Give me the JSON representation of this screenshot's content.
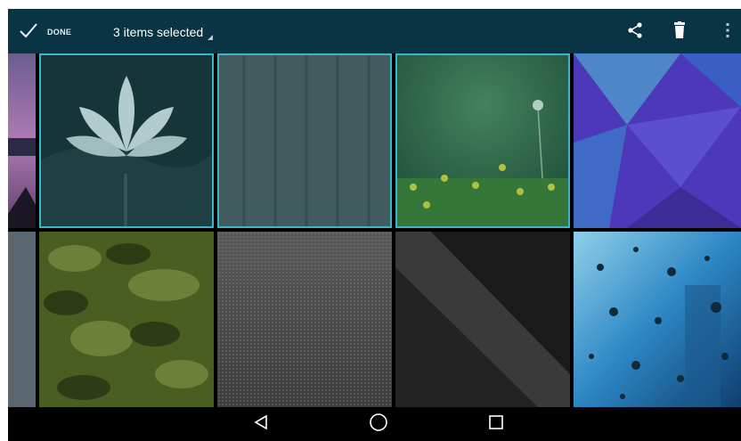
{
  "actionbar": {
    "done_label": "DONE",
    "selection_text": "3 items selected",
    "icons": {
      "done": "check-icon",
      "share": "share-icon",
      "delete": "trash-icon",
      "overflow": "more-vert-icon"
    }
  },
  "colors": {
    "actionbar": "#093444",
    "selection_highlight": "#3bb5c9",
    "navbar": "#000000"
  },
  "grid": {
    "row1": [
      "sunset-lake",
      "white-lotus",
      "wood-planks",
      "dandelion-field",
      "blue-polygons"
    ],
    "row2": [
      "grey-slate",
      "green-camouflage",
      "grey-mesh",
      "dark-diagonal",
      "rain-drops"
    ],
    "selected": [
      "white-lotus",
      "wood-planks",
      "dandelion-field"
    ]
  },
  "navbar": {
    "icons": [
      "back-icon",
      "home-icon",
      "recents-icon"
    ]
  }
}
